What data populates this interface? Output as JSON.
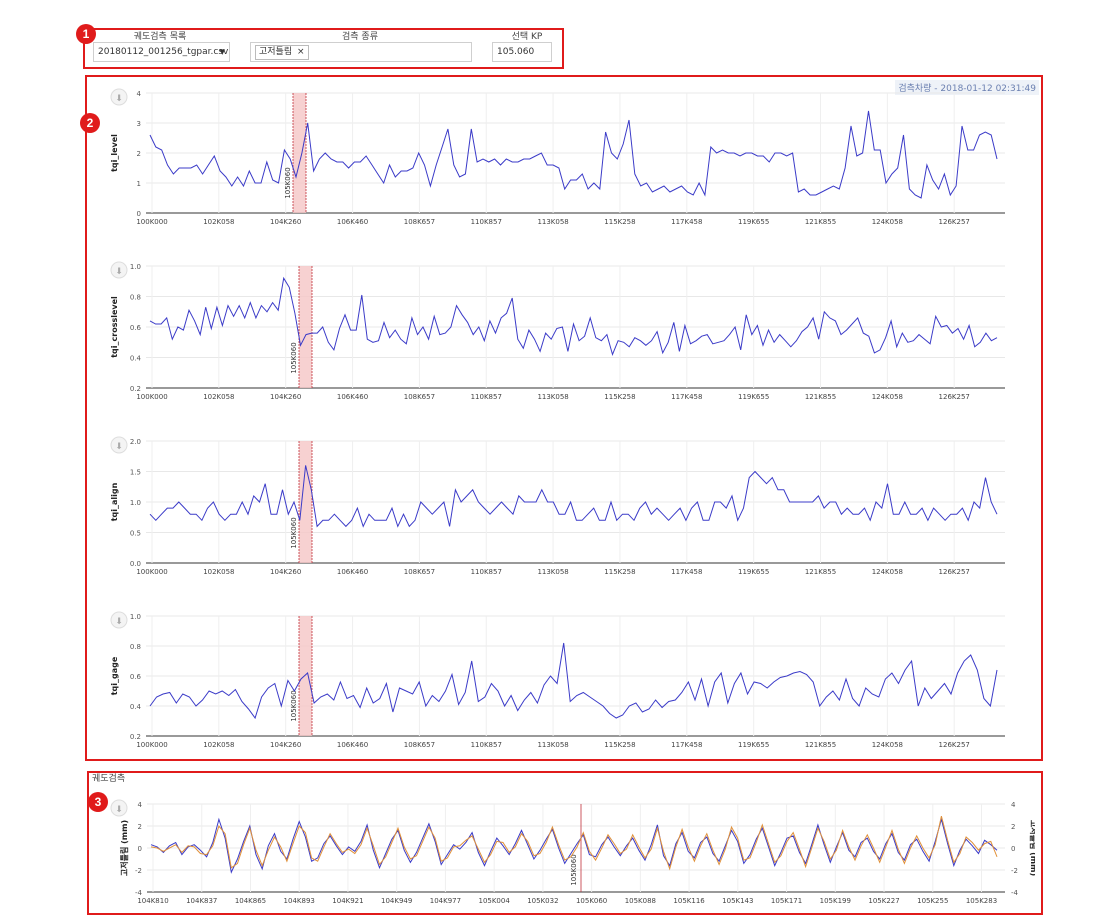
{
  "controls": {
    "badge_1": "1",
    "track_label": "궤도검측 목록",
    "track_value": "20180112_001256_tgpar.csv",
    "type_label": "검측 종류",
    "type_chip": "고저틀림",
    "kp_label": "선택 KP",
    "kp_value": "105.060"
  },
  "top_panel": {
    "badge_2": "2",
    "timestamp": "검측차량 - 2018-01-12 02:31:49",
    "marker_label": "105K060"
  },
  "bottom_panel": {
    "badge_3": "3",
    "section_title": "궤도검측",
    "marker_label": "105K060"
  },
  "colors": {
    "series": "#3b3bc8",
    "series2": "#e0913a",
    "highlight": "#f5c6c6",
    "marker": "#c0303a",
    "frame": "#e01b1b"
  },
  "chart_data": [
    {
      "type": "line",
      "ylabel": "tqi_level",
      "ylim": [
        0,
        4
      ],
      "yticks": [
        "0",
        "1",
        "2",
        "3",
        "4"
      ],
      "xticks": [
        "100K000",
        "102K058",
        "104K260",
        "106K460",
        "108K657",
        "110K857",
        "113K058",
        "115K258",
        "117K458",
        "119K655",
        "121K855",
        "124K058",
        "126K257"
      ],
      "highlight_kp": 105.06,
      "series": [
        {
          "values": [
            2.6,
            2.2,
            2.1,
            1.6,
            1.3,
            1.5,
            1.5,
            1.5,
            1.6,
            1.3,
            1.6,
            1.9,
            1.4,
            1.2,
            0.9,
            1.2,
            0.9,
            1.4,
            1.0,
            1.0,
            1.7,
            1.1,
            1.0,
            2.1,
            1.8,
            1.2,
            2.0,
            3.0,
            1.4,
            1.8,
            2.0,
            1.8,
            1.7,
            1.7,
            1.5,
            1.7,
            1.7,
            1.9,
            1.6,
            1.3,
            1.0,
            1.6,
            1.2,
            1.4,
            1.4,
            1.5,
            2.0,
            1.6,
            0.9,
            1.6,
            2.2,
            2.8,
            1.6,
            1.2,
            1.3,
            2.8,
            1.7,
            1.8,
            1.7,
            1.8,
            1.6,
            1.8,
            1.7,
            1.7,
            1.8,
            1.8,
            1.9,
            2.0,
            1.6,
            1.6,
            1.5,
            0.8,
            1.1,
            1.1,
            1.3,
            0.8,
            1.0,
            0.8,
            2.7,
            2.0,
            1.8,
            2.3,
            3.1,
            1.3,
            0.9,
            1.0,
            0.7,
            0.8,
            0.9,
            0.7,
            0.8,
            0.9,
            0.7,
            0.6,
            1.0,
            0.6,
            2.2,
            2.0,
            2.1,
            2.0,
            2.0,
            1.9,
            2.0,
            2.0,
            1.9,
            1.9,
            1.7,
            2.0,
            2.0,
            1.9,
            2.0,
            0.7,
            0.8,
            0.6,
            0.6,
            0.7,
            0.8,
            0.9,
            0.8,
            1.5,
            2.9,
            1.9,
            2.0,
            3.4,
            2.1,
            2.1,
            1.0,
            1.3,
            1.5,
            2.6,
            0.8,
            0.6,
            0.5,
            1.6,
            1.1,
            0.8,
            1.3,
            0.6,
            0.9,
            2.9,
            2.1,
            2.1,
            2.6,
            2.7,
            2.6,
            1.8
          ]
        }
      ]
    },
    {
      "type": "line",
      "ylabel": "tqi_crosslevel",
      "ylim": [
        0.2,
        1.0
      ],
      "yticks": [
        "0.2",
        "0.4",
        "0.6",
        "0.8",
        "1.0"
      ],
      "xticks": [
        "100K000",
        "102K058",
        "104K260",
        "106K460",
        "108K657",
        "110K857",
        "113K058",
        "115K258",
        "117K458",
        "119K655",
        "121K855",
        "124K058",
        "126K257"
      ],
      "highlight_kp": 105.06,
      "series": [
        {
          "values": [
            0.64,
            0.62,
            0.62,
            0.66,
            0.52,
            0.6,
            0.58,
            0.71,
            0.64,
            0.55,
            0.73,
            0.59,
            0.73,
            0.61,
            0.74,
            0.67,
            0.74,
            0.66,
            0.76,
            0.66,
            0.74,
            0.7,
            0.76,
            0.71,
            0.92,
            0.86,
            0.69,
            0.48,
            0.55,
            0.56,
            0.56,
            0.6,
            0.5,
            0.45,
            0.59,
            0.68,
            0.58,
            0.58,
            0.81,
            0.52,
            0.5,
            0.51,
            0.63,
            0.53,
            0.58,
            0.52,
            0.49,
            0.66,
            0.55,
            0.6,
            0.52,
            0.67,
            0.55,
            0.56,
            0.6,
            0.74,
            0.68,
            0.63,
            0.55,
            0.6,
            0.51,
            0.64,
            0.56,
            0.66,
            0.69,
            0.79,
            0.52,
            0.46,
            0.58,
            0.52,
            0.44,
            0.56,
            0.52,
            0.59,
            0.6,
            0.44,
            0.62,
            0.51,
            0.54,
            0.66,
            0.53,
            0.51,
            0.55,
            0.42,
            0.51,
            0.5,
            0.47,
            0.53,
            0.51,
            0.48,
            0.51,
            0.57,
            0.43,
            0.5,
            0.63,
            0.44,
            0.61,
            0.49,
            0.51,
            0.54,
            0.55,
            0.49,
            0.5,
            0.51,
            0.55,
            0.6,
            0.45,
            0.68,
            0.55,
            0.61,
            0.48,
            0.58,
            0.5,
            0.55,
            0.51,
            0.47,
            0.51,
            0.57,
            0.6,
            0.66,
            0.52,
            0.7,
            0.66,
            0.64,
            0.55,
            0.58,
            0.62,
            0.66,
            0.56,
            0.54,
            0.43,
            0.45,
            0.53,
            0.64,
            0.47,
            0.56,
            0.5,
            0.51,
            0.55,
            0.52,
            0.49,
            0.67,
            0.6,
            0.61,
            0.56,
            0.59,
            0.52,
            0.61,
            0.47,
            0.5,
            0.56,
            0.51,
            0.53
          ]
        }
      ]
    },
    {
      "type": "line",
      "ylabel": "tqi_align",
      "ylim": [
        0.0,
        2.0
      ],
      "yticks": [
        "0.0",
        "0.5",
        "1.0",
        "1.5",
        "2.0"
      ],
      "xticks": [
        "100K000",
        "102K058",
        "104K260",
        "106K460",
        "108K657",
        "110K857",
        "113K058",
        "115K258",
        "117K458",
        "119K655",
        "121K855",
        "124K058",
        "126K257"
      ],
      "highlight_kp": 105.06,
      "series": [
        {
          "values": [
            0.8,
            0.7,
            0.8,
            0.9,
            0.9,
            1.0,
            0.9,
            0.8,
            0.8,
            0.7,
            0.9,
            1.0,
            0.8,
            0.7,
            0.8,
            0.8,
            1.0,
            0.8,
            1.1,
            1.0,
            1.3,
            0.8,
            0.8,
            1.2,
            0.8,
            1.0,
            0.7,
            1.6,
            1.2,
            0.6,
            0.7,
            0.7,
            0.8,
            0.7,
            0.6,
            0.7,
            0.9,
            0.6,
            0.8,
            0.7,
            0.7,
            0.7,
            0.9,
            0.6,
            0.8,
            0.6,
            0.7,
            1.0,
            0.9,
            0.8,
            0.9,
            1.0,
            0.6,
            1.2,
            1.0,
            1.1,
            1.2,
            1.0,
            0.9,
            0.8,
            0.9,
            1.0,
            0.9,
            0.8,
            1.1,
            1.0,
            1.0,
            1.0,
            1.2,
            1.0,
            1.0,
            0.8,
            0.8,
            1.0,
            0.7,
            0.7,
            0.8,
            0.9,
            0.7,
            0.7,
            1.0,
            0.7,
            0.8,
            0.8,
            0.7,
            0.9,
            1.0,
            0.8,
            0.9,
            0.8,
            0.7,
            0.8,
            0.9,
            0.7,
            0.9,
            1.0,
            0.7,
            0.7,
            1.0,
            1.0,
            0.9,
            1.1,
            0.7,
            0.9,
            1.4,
            1.5,
            1.4,
            1.3,
            1.4,
            1.2,
            1.2,
            1.0,
            1.0,
            1.0,
            1.0,
            1.0,
            1.1,
            0.9,
            1.0,
            1.0,
            0.8,
            0.9,
            0.8,
            0.8,
            0.9,
            0.7,
            1.0,
            0.9,
            1.3,
            0.8,
            0.8,
            1.0,
            0.8,
            0.8,
            0.9,
            0.7,
            0.9,
            0.8,
            0.7,
            0.8,
            0.8,
            0.9,
            0.7,
            1.0,
            0.9,
            1.4,
            1.0,
            0.8
          ]
        }
      ]
    },
    {
      "type": "line",
      "ylabel": "tqi_gage",
      "ylim": [
        0.2,
        1.0
      ],
      "yticks": [
        "0.2",
        "0.4",
        "0.6",
        "0.8",
        "1.0"
      ],
      "xticks": [
        "100K000",
        "102K058",
        "104K260",
        "106K460",
        "108K657",
        "110K857",
        "113K058",
        "115K258",
        "117K458",
        "119K655",
        "121K855",
        "124K058",
        "126K257"
      ],
      "highlight_kp": 105.06,
      "series": [
        {
          "values": [
            0.4,
            0.46,
            0.48,
            0.49,
            0.42,
            0.48,
            0.46,
            0.4,
            0.44,
            0.5,
            0.48,
            0.5,
            0.47,
            0.51,
            0.43,
            0.38,
            0.32,
            0.46,
            0.52,
            0.55,
            0.4,
            0.57,
            0.5,
            0.58,
            0.62,
            0.42,
            0.46,
            0.48,
            0.44,
            0.56,
            0.45,
            0.47,
            0.39,
            0.52,
            0.42,
            0.45,
            0.55,
            0.36,
            0.52,
            0.5,
            0.48,
            0.56,
            0.4,
            0.47,
            0.43,
            0.5,
            0.61,
            0.41,
            0.49,
            0.7,
            0.43,
            0.46,
            0.55,
            0.5,
            0.4,
            0.47,
            0.37,
            0.44,
            0.49,
            0.42,
            0.54,
            0.6,
            0.55,
            0.82,
            0.43,
            0.47,
            0.49,
            0.46,
            0.43,
            0.4,
            0.35,
            0.32,
            0.34,
            0.4,
            0.42,
            0.36,
            0.38,
            0.44,
            0.39,
            0.43,
            0.44,
            0.49,
            0.56,
            0.44,
            0.58,
            0.4,
            0.56,
            0.62,
            0.42,
            0.55,
            0.62,
            0.48,
            0.56,
            0.55,
            0.52,
            0.56,
            0.59,
            0.6,
            0.62,
            0.63,
            0.61,
            0.56,
            0.4,
            0.46,
            0.5,
            0.44,
            0.58,
            0.45,
            0.4,
            0.52,
            0.48,
            0.46,
            0.58,
            0.62,
            0.55,
            0.64,
            0.7,
            0.4,
            0.52,
            0.45,
            0.5,
            0.55,
            0.48,
            0.62,
            0.7,
            0.74,
            0.64,
            0.45,
            0.4,
            0.64
          ]
        }
      ]
    },
    {
      "type": "line",
      "ylabel": "고저틀림 (mm)",
      "y2label": "고저틀림 (mm)",
      "ylim": [
        -4,
        4
      ],
      "yticks": [
        "-4",
        "-2",
        "0",
        "2",
        "4"
      ],
      "xticks": [
        "104K810",
        "104K837",
        "104K865",
        "104K893",
        "104K921",
        "104K949",
        "104K977",
        "105K004",
        "105K032",
        "105K060",
        "105K088",
        "105K116",
        "105K143",
        "105K171",
        "105K199",
        "105K227",
        "105K255",
        "105K283"
      ],
      "highlight_kp": 105.06,
      "series": [
        {
          "values": [
            0.3,
            0.1,
            -0.4,
            0.2,
            0.5,
            -0.6,
            0.1,
            0.3,
            -0.2,
            -0.8,
            0.5,
            2.6,
            0.9,
            -2.2,
            -1.0,
            0.6,
            2.0,
            -0.6,
            -1.9,
            0.2,
            1.3,
            -0.3,
            -1.0,
            0.8,
            2.4,
            1.0,
            -1.2,
            -0.9,
            0.4,
            1.1,
            0.2,
            -0.6,
            0.1,
            -0.3,
            0.6,
            2.1,
            -0.2,
            -1.8,
            -0.5,
            0.8,
            1.6,
            -0.2,
            -1.3,
            -0.4,
            0.9,
            2.2,
            0.6,
            -1.5,
            -0.6,
            0.3,
            -0.1,
            0.5,
            1.4,
            -0.4,
            -1.6,
            -0.3,
            0.9,
            0.2,
            -0.6,
            0.4,
            1.6,
            0.3,
            -1.0,
            -0.2,
            0.8,
            1.7,
            0.0,
            -1.4,
            -0.5,
            0.4,
            1.2,
            -0.6,
            -0.8,
            0.3,
            1.0,
            0.1,
            -0.7,
            0.2,
            0.9,
            -0.2,
            -1.1,
            0.3,
            2.1,
            -0.7,
            -1.6,
            0.4,
            1.4,
            -0.3,
            -0.9,
            0.5,
            1.0,
            -0.5,
            -1.2,
            0.2,
            1.6,
            0.6,
            -1.4,
            -0.6,
            0.8,
            1.8,
            0.1,
            -1.6,
            -0.4,
            0.9,
            1.1,
            -0.4,
            -1.4,
            0.3,
            2.1,
            0.3,
            -1.3,
            0.1,
            1.4,
            -0.2,
            -0.8,
            0.5,
            0.9,
            -0.3,
            -1.0,
            0.4,
            1.3,
            -0.4,
            -1.1,
            0.3,
            0.8,
            -0.3,
            -1.2,
            0.6,
            2.6,
            0.4,
            -1.6,
            -0.2,
            0.8,
            0.2,
            -0.5,
            0.7,
            0.3,
            -0.2
          ]
        },
        {
          "values": [
            0.1,
            0.0,
            -0.3,
            0.0,
            0.3,
            -0.4,
            0.2,
            0.1,
            -0.5,
            -0.6,
            0.2,
            2.0,
            1.3,
            -1.8,
            -1.4,
            0.3,
            1.8,
            -0.2,
            -1.6,
            -0.2,
            1.0,
            0.1,
            -1.2,
            0.4,
            2.0,
            1.4,
            -0.9,
            -1.2,
            0.1,
            1.3,
            0.4,
            -0.4,
            -0.1,
            -0.5,
            0.3,
            1.8,
            0.2,
            -1.5,
            -0.8,
            0.5,
            1.8,
            0.1,
            -1.0,
            -0.7,
            0.6,
            1.9,
            0.9,
            -1.2,
            -0.9,
            0.1,
            0.2,
            0.7,
            1.1,
            -0.1,
            -1.3,
            -0.6,
            0.6,
            0.5,
            -0.4,
            0.1,
            1.3,
            0.6,
            -0.7,
            -0.5,
            0.5,
            1.9,
            0.3,
            -1.1,
            -0.8,
            0.1,
            1.4,
            -0.3,
            -1.1,
            0.0,
            1.2,
            0.4,
            -0.5,
            -0.1,
            1.2,
            0.1,
            -0.9,
            -0.1,
            1.8,
            -0.3,
            -1.9,
            0.1,
            1.7,
            0.1,
            -1.2,
            0.2,
            1.3,
            -0.2,
            -1.5,
            -0.1,
            1.9,
            0.9,
            -1.1,
            -0.9,
            0.5,
            2.1,
            0.4,
            -1.3,
            -0.7,
            0.6,
            1.4,
            -0.1,
            -1.7,
            0.0,
            1.8,
            0.6,
            -1.0,
            -0.2,
            1.6,
            0.1,
            -1.1,
            0.2,
            1.2,
            0.0,
            -1.3,
            0.1,
            1.6,
            -0.1,
            -1.4,
            0.0,
            1.1,
            0.0,
            -0.9,
            0.3,
            2.9,
            0.7,
            -1.3,
            -0.5,
            1.0,
            0.5,
            -0.2,
            0.4,
            0.6,
            -0.8
          ]
        }
      ]
    }
  ]
}
